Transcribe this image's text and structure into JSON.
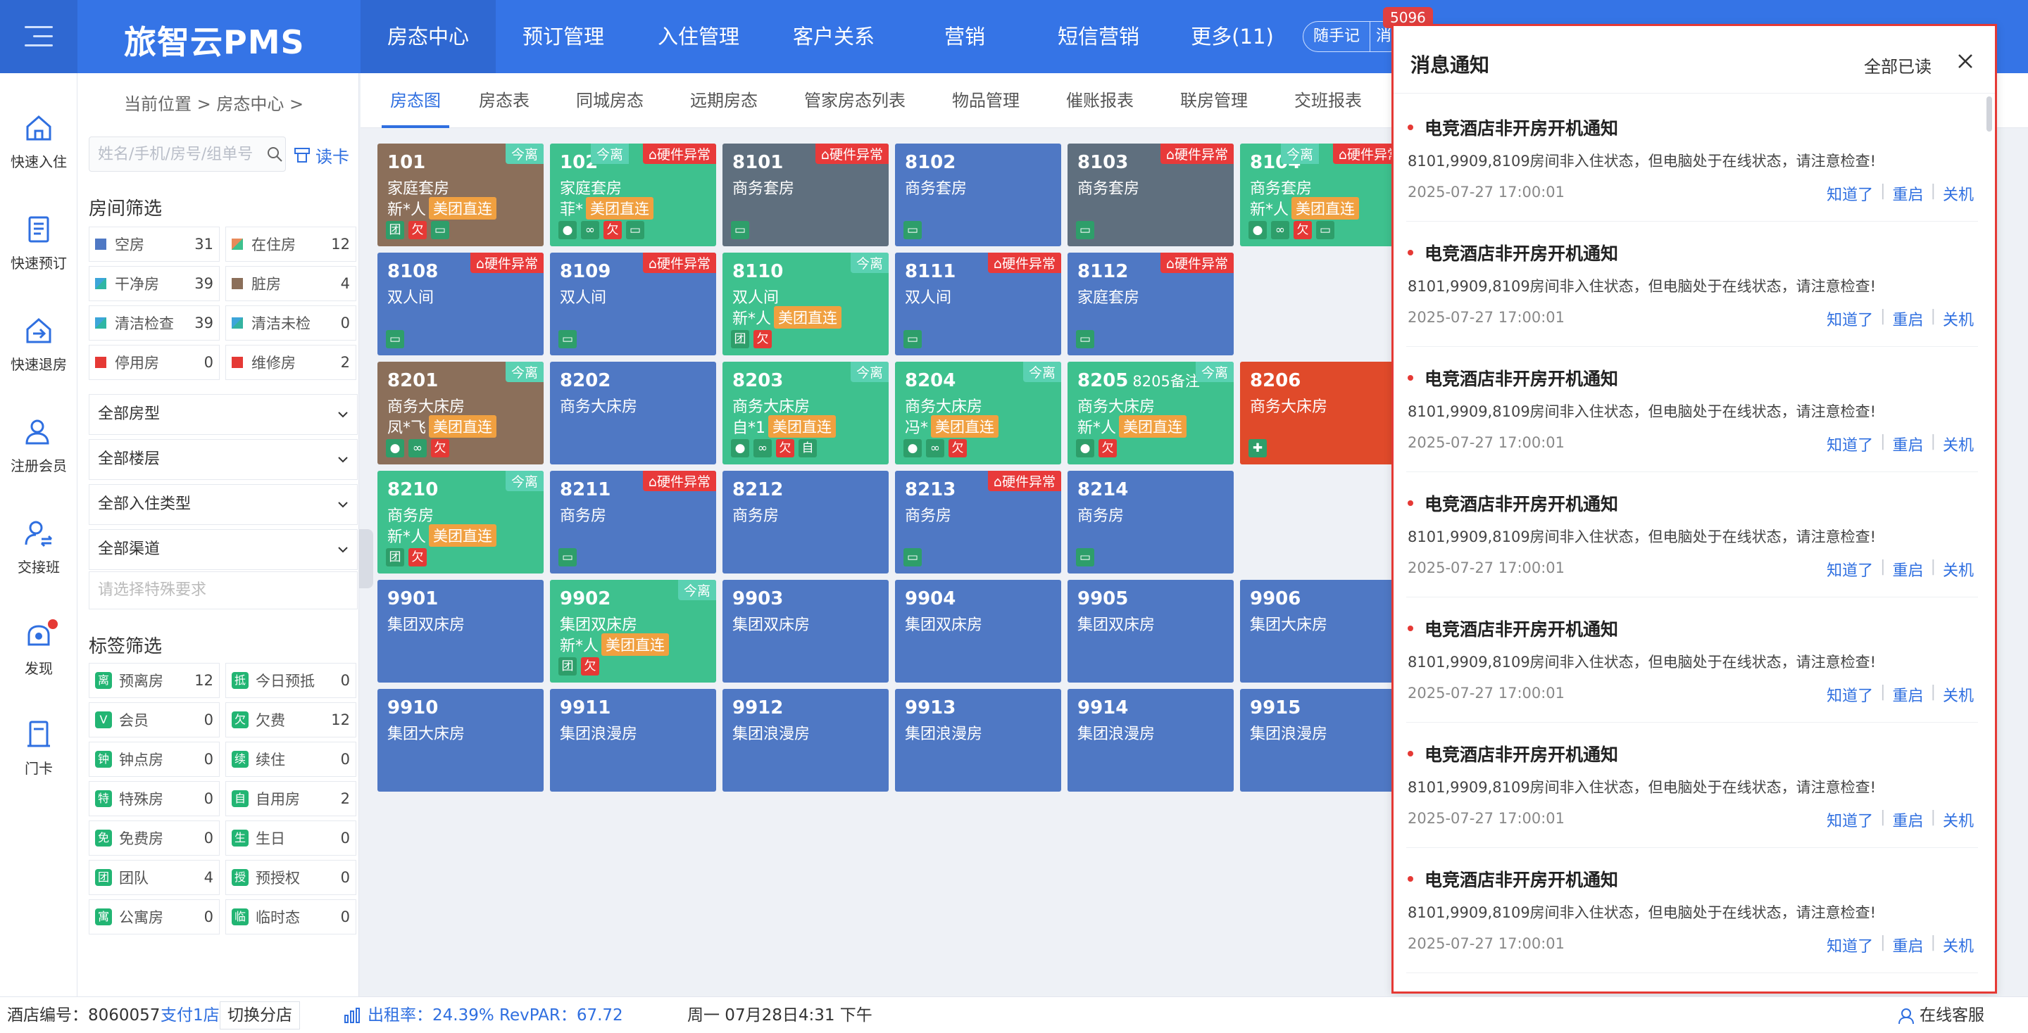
{
  "header": {
    "logo": "旅智云PMS",
    "nav": [
      "房态中心",
      "预订管理",
      "入住管理",
      "客户关系",
      "营销",
      "短信营销",
      "更多(11)"
    ],
    "quick_note": "随手记",
    "quick_note_2": "消",
    "badge_count": "5096",
    "accent_color": "#3574e6"
  },
  "rail": [
    {
      "label": "快速入住",
      "icon": "home-icon"
    },
    {
      "label": "快速预订",
      "icon": "booking-icon"
    },
    {
      "label": "快速退房",
      "icon": "checkout-icon"
    },
    {
      "label": "注册会员",
      "icon": "user-add-icon"
    },
    {
      "label": "交接班",
      "icon": "handover-icon"
    },
    {
      "label": "发现",
      "icon": "discover-icon"
    },
    {
      "label": "门卡",
      "icon": "card-icon"
    }
  ],
  "filter": {
    "breadcrumb": "当前位置  >  房态中心  >",
    "search_placeholder": "姓名/手机/房号/组单号",
    "read_card": "读卡",
    "room_filter_title": "房间筛选",
    "room_stats": [
      {
        "name": "空房",
        "count": "31",
        "color": "#4f78c4"
      },
      {
        "name": "在住房",
        "count": "12",
        "color": "#e88a5a"
      },
      {
        "name": "干净房",
        "count": "39",
        "color": "#2fb6a4"
      },
      {
        "name": "脏房",
        "count": "4",
        "color": "#8b6f5a"
      },
      {
        "name": "清洁检查",
        "count": "39",
        "color": "#3da5d9"
      },
      {
        "name": "清洁未检",
        "count": "0",
        "color": "#34b3a0"
      },
      {
        "name": "停用房",
        "count": "0",
        "color": "#e53935"
      },
      {
        "name": "维修房",
        "count": "2",
        "color": "#e53935"
      }
    ],
    "dropdowns": [
      "全部房型",
      "全部楼层",
      "全部入住类型",
      "全部渠道"
    ],
    "special_placeholder": "请选择特殊要求",
    "tag_filter_title": "标签筛选",
    "tag_stats": [
      {
        "icon": "离",
        "name": "预离房",
        "count": "12",
        "color": "#22b573"
      },
      {
        "icon": "抵",
        "name": "今日预抵",
        "count": "0",
        "color": "#22b573"
      },
      {
        "icon": "V",
        "name": "会员",
        "count": "0",
        "color": "#22b573"
      },
      {
        "icon": "欠",
        "name": "欠费",
        "count": "12",
        "color": "#22b573"
      },
      {
        "icon": "钟",
        "name": "钟点房",
        "count": "0",
        "color": "#22b573"
      },
      {
        "icon": "续",
        "name": "续住",
        "count": "0",
        "color": "#22b573"
      },
      {
        "icon": "特",
        "name": "特殊房",
        "count": "0",
        "color": "#22b573"
      },
      {
        "icon": "自",
        "name": "自用房",
        "count": "2",
        "color": "#22b573"
      },
      {
        "icon": "免",
        "name": "免费房",
        "count": "0",
        "color": "#22b573"
      },
      {
        "icon": "生",
        "name": "生日",
        "count": "0",
        "color": "#22b573"
      },
      {
        "icon": "团",
        "name": "团队",
        "count": "4",
        "color": "#22b573"
      },
      {
        "icon": "授",
        "name": "预授权",
        "count": "0",
        "color": "#22b573"
      },
      {
        "icon": "寓",
        "name": "公寓房",
        "count": "0",
        "color": "#22b573"
      },
      {
        "icon": "临",
        "name": "临时态",
        "count": "0",
        "color": "#22b573"
      }
    ]
  },
  "tabs": [
    "房态图",
    "房态表",
    "同城房态",
    "远期房态",
    "管家房态列表",
    "物品管理",
    "催账报表",
    "联房管理",
    "交班报表"
  ],
  "rooms": [
    {
      "num": "101",
      "type": "家庭套房",
      "guest": "新*人",
      "channel": "美团直连",
      "color": "#8b6f5a",
      "off": "今离",
      "hw": "",
      "icons": [
        "团",
        "欠",
        "屏"
      ],
      "note": ""
    },
    {
      "num": "102",
      "type": "家庭套房",
      "guest": "菲*",
      "channel": "美团直连",
      "color": "#3ec18e",
      "off": "今离",
      "hw": "硬件异常",
      "icons": [
        "人",
        "链",
        "欠",
        "屏"
      ],
      "note": ""
    },
    {
      "num": "8101",
      "type": "商务套房",
      "guest": "",
      "channel": "",
      "color": "#5f6f7e",
      "off": "",
      "hw": "硬件异常",
      "icons": [
        "屏"
      ],
      "note": ""
    },
    {
      "num": "8102",
      "type": "商务套房",
      "guest": "",
      "channel": "",
      "color": "#4f78c4",
      "off": "",
      "hw": "",
      "icons": [
        "屏"
      ],
      "note": ""
    },
    {
      "num": "8103",
      "type": "商务套房",
      "guest": "",
      "channel": "",
      "color": "#5f6f7e",
      "off": "",
      "hw": "硬件异常",
      "icons": [
        "屏"
      ],
      "note": ""
    },
    {
      "num": "8104",
      "type": "商务套房",
      "guest": "新*人",
      "channel": "美团直连",
      "color": "#3ec18e",
      "off": "今离",
      "hw": "硬件异常",
      "icons": [
        "人",
        "链",
        "欠",
        "屏"
      ],
      "note": ""
    },
    {
      "num": "8108",
      "type": "双人间",
      "guest": "",
      "channel": "",
      "color": "#4f78c4",
      "off": "",
      "hw": "硬件异常",
      "icons": [
        "屏"
      ],
      "note": ""
    },
    {
      "num": "8109",
      "type": "双人间",
      "guest": "",
      "channel": "",
      "color": "#4f78c4",
      "off": "",
      "hw": "硬件异常",
      "icons": [
        "屏"
      ],
      "note": ""
    },
    {
      "num": "8110",
      "type": "双人间",
      "guest": "新*人",
      "channel": "美团直连",
      "color": "#3ec18e",
      "off": "今离",
      "hw": "",
      "icons": [
        "团",
        "欠"
      ],
      "note": ""
    },
    {
      "num": "8111",
      "type": "双人间",
      "guest": "",
      "channel": "",
      "color": "#4f78c4",
      "off": "",
      "hw": "硬件异常",
      "icons": [
        "屏"
      ],
      "note": ""
    },
    {
      "num": "8112",
      "type": "家庭套房",
      "guest": "",
      "channel": "",
      "color": "#4f78c4",
      "off": "",
      "hw": "硬件异常",
      "icons": [
        "屏"
      ],
      "note": ""
    },
    {
      "num": "8201",
      "type": "商务大床房",
      "guest": "凤*飞",
      "channel": "美团直连",
      "color": "#8b6f5a",
      "off": "今离",
      "hw": "",
      "icons": [
        "人",
        "链",
        "欠"
      ],
      "note": ""
    },
    {
      "num": "8202",
      "type": "商务大床房",
      "guest": "",
      "channel": "",
      "color": "#4f78c4",
      "off": "",
      "hw": "",
      "icons": [],
      "note": ""
    },
    {
      "num": "8203",
      "type": "商务大床房",
      "guest": "自*1",
      "channel": "美团直连",
      "color": "#3ec18e",
      "off": "今离",
      "hw": "",
      "icons": [
        "人",
        "链",
        "欠",
        "自"
      ],
      "note": ""
    },
    {
      "num": "8204",
      "type": "商务大床房",
      "guest": "冯*",
      "channel": "美团直连",
      "color": "#3ec18e",
      "off": "今离",
      "hw": "",
      "icons": [
        "人",
        "链",
        "欠"
      ],
      "note": ""
    },
    {
      "num": "8205",
      "type": "商务大床房",
      "guest": "新*人",
      "channel": "美团直连",
      "color": "#3ec18e",
      "off": "今离",
      "hw": "",
      "icons": [
        "人",
        "欠"
      ],
      "note": "8205备注"
    },
    {
      "num": "8206",
      "type": "商务大床房",
      "guest": "",
      "channel": "",
      "color": "#e04a2a",
      "off": "",
      "hw": "",
      "icons": [
        "修"
      ],
      "note": ""
    },
    {
      "num": "8210",
      "type": "商务房",
      "guest": "新*人",
      "channel": "美团直连",
      "color": "#3ec18e",
      "off": "今离",
      "hw": "",
      "icons": [
        "团",
        "欠"
      ],
      "note": ""
    },
    {
      "num": "8211",
      "type": "商务房",
      "guest": "",
      "channel": "",
      "color": "#4f78c4",
      "off": "",
      "hw": "硬件异常",
      "icons": [
        "屏"
      ],
      "note": ""
    },
    {
      "num": "8212",
      "type": "商务房",
      "guest": "",
      "channel": "",
      "color": "#4f78c4",
      "off": "",
      "hw": "",
      "icons": [],
      "note": ""
    },
    {
      "num": "8213",
      "type": "商务房",
      "guest": "",
      "channel": "",
      "color": "#4f78c4",
      "off": "",
      "hw": "硬件异常",
      "icons": [
        "屏"
      ],
      "note": ""
    },
    {
      "num": "8214",
      "type": "商务房",
      "guest": "",
      "channel": "",
      "color": "#4f78c4",
      "off": "",
      "hw": "",
      "icons": [
        "屏"
      ],
      "note": ""
    },
    {
      "num": "9901",
      "type": "集团双床房",
      "guest": "",
      "channel": "",
      "color": "#4f78c4",
      "off": "",
      "hw": "",
      "icons": [],
      "note": ""
    },
    {
      "num": "9902",
      "type": "集团双床房",
      "guest": "新*人",
      "channel": "美团直连",
      "color": "#3ec18e",
      "off": "今离",
      "hw": "",
      "icons": [
        "团",
        "欠"
      ],
      "note": ""
    },
    {
      "num": "9903",
      "type": "集团双床房",
      "guest": "",
      "channel": "",
      "color": "#4f78c4",
      "off": "",
      "hw": "",
      "icons": [],
      "note": ""
    },
    {
      "num": "9904",
      "type": "集团双床房",
      "guest": "",
      "channel": "",
      "color": "#4f78c4",
      "off": "",
      "hw": "",
      "icons": [],
      "note": ""
    },
    {
      "num": "9905",
      "type": "集团双床房",
      "guest": "",
      "channel": "",
      "color": "#4f78c4",
      "off": "",
      "hw": "",
      "icons": [],
      "note": ""
    },
    {
      "num": "9906",
      "type": "集团大床房",
      "guest": "",
      "channel": "",
      "color": "#4f78c4",
      "off": "",
      "hw": "",
      "icons": [],
      "note": ""
    },
    {
      "num": "9910",
      "type": "集团大床房",
      "guest": "",
      "channel": "",
      "color": "#4f78c4",
      "off": "",
      "hw": "",
      "icons": [],
      "note": ""
    },
    {
      "num": "9911",
      "type": "集团浪漫房",
      "guest": "",
      "channel": "",
      "color": "#4f78c4",
      "off": "",
      "hw": "",
      "icons": [],
      "note": ""
    },
    {
      "num": "9912",
      "type": "集团浪漫房",
      "guest": "",
      "channel": "",
      "color": "#4f78c4",
      "off": "",
      "hw": "",
      "icons": [],
      "note": ""
    },
    {
      "num": "9913",
      "type": "集团浪漫房",
      "guest": "",
      "channel": "",
      "color": "#4f78c4",
      "off": "",
      "hw": "",
      "icons": [],
      "note": ""
    },
    {
      "num": "9914",
      "type": "集团浪漫房",
      "guest": "",
      "channel": "",
      "color": "#4f78c4",
      "off": "",
      "hw": "",
      "icons": [],
      "note": ""
    },
    {
      "num": "9915",
      "type": "集团浪漫房",
      "guest": "",
      "channel": "",
      "color": "#4f78c4",
      "off": "",
      "hw": "",
      "icons": [],
      "note": ""
    }
  ],
  "notice": {
    "title": "消息通知",
    "mark_all": "全部已读",
    "messages": [
      {
        "title": "电竞酒店非开房开机通知",
        "body": "8101,9909,8109房间非入住状态，但电脑处于在线状态，请注意检查!",
        "date": "2025-07-27 17:00:01"
      },
      {
        "title": "电竞酒店非开房开机通知",
        "body": "8101,9909,8109房间非入住状态，但电脑处于在线状态，请注意检查!",
        "date": "2025-07-27 17:00:01"
      },
      {
        "title": "电竞酒店非开房开机通知",
        "body": "8101,9909,8109房间非入住状态，但电脑处于在线状态，请注意检查!",
        "date": "2025-07-27 17:00:01"
      },
      {
        "title": "电竞酒店非开房开机通知",
        "body": "8101,9909,8109房间非入住状态，但电脑处于在线状态，请注意检查!",
        "date": "2025-07-27 17:00:01"
      },
      {
        "title": "电竞酒店非开房开机通知",
        "body": "8101,9909,8109房间非入住状态，但电脑处于在线状态，请注意检查!",
        "date": "2025-07-27 17:00:01"
      },
      {
        "title": "电竞酒店非开房开机通知",
        "body": "8101,9909,8109房间非入住状态，但电脑处于在线状态，请注意检查!",
        "date": "2025-07-27 17:00:01"
      },
      {
        "title": "电竞酒店非开房开机通知",
        "body": "8101,9909,8109房间非入住状态，但电脑处于在线状态，请注意检查!",
        "date": "2025-07-27 17:00:01"
      }
    ],
    "actions": [
      "知道了",
      "重启",
      "关机"
    ]
  },
  "footer": {
    "hotel_no": "酒店编号：8060057",
    "branch": "支付1店",
    "switch": "切换分店",
    "occupancy": "出租率：24.39% RevPAR：67.72",
    "datetime": "周一  07月28日4:31 下午",
    "service": "在线客服"
  }
}
